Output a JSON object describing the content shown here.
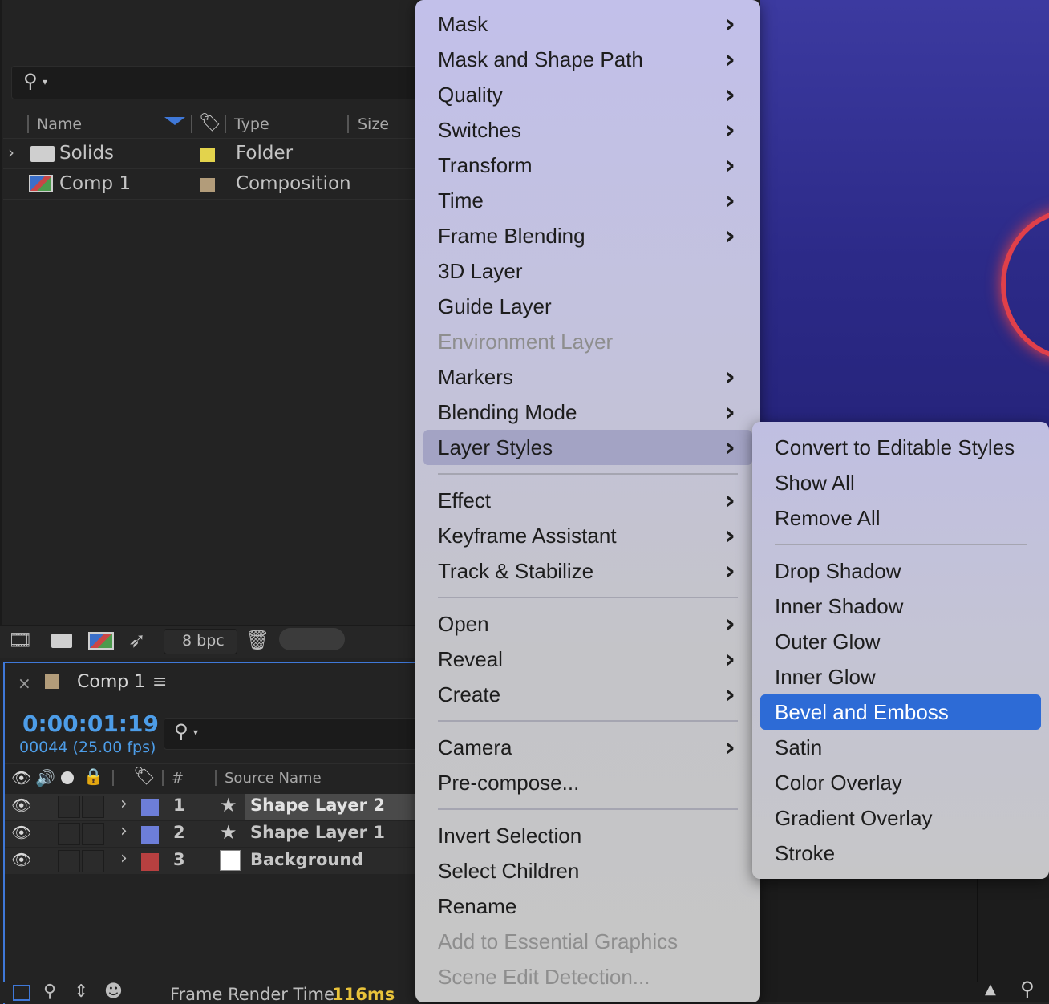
{
  "project": {
    "columns": {
      "name": "Name",
      "type": "Type",
      "size": "Size"
    },
    "items": [
      {
        "name": "Solids",
        "type": "Folder",
        "label_color": "#e3d34c"
      },
      {
        "name": "Comp 1",
        "type": "Composition",
        "label_color": "#b29c7a"
      }
    ],
    "bit_depth": "8 bpc"
  },
  "timeline": {
    "comp_tab": "Comp 1",
    "timecode": "0:00:01:19",
    "frame_info": "00044 (25.00 fps)",
    "columns": {
      "number": "#",
      "source_name": "Source Name"
    },
    "layers": [
      {
        "number": "1",
        "name": "Shape Layer 2",
        "label_color": "#6d7ed8"
      },
      {
        "number": "2",
        "name": "Shape Layer 1",
        "label_color": "#6d7ed8"
      },
      {
        "number": "3",
        "name": "Background",
        "label_color": "#b84040"
      }
    ],
    "frame_render_label": "Frame Render Time",
    "frame_render_value": "116ms"
  },
  "menu": {
    "items": [
      {
        "label": "Mask",
        "submenu": true
      },
      {
        "label": "Mask and Shape Path",
        "submenu": true
      },
      {
        "label": "Quality",
        "submenu": true
      },
      {
        "label": "Switches",
        "submenu": true
      },
      {
        "label": "Transform",
        "submenu": true
      },
      {
        "label": "Time",
        "submenu": true
      },
      {
        "label": "Frame Blending",
        "submenu": true
      },
      {
        "label": "3D Layer",
        "submenu": false
      },
      {
        "label": "Guide Layer",
        "submenu": false
      },
      {
        "label": "Environment Layer",
        "submenu": false,
        "disabled": true
      },
      {
        "label": "Markers",
        "submenu": true
      },
      {
        "label": "Blending Mode",
        "submenu": true
      },
      {
        "label": "Layer Styles",
        "submenu": true,
        "highlighted": true
      },
      {
        "label": "Effect",
        "submenu": true
      },
      {
        "label": "Keyframe Assistant",
        "submenu": true
      },
      {
        "label": "Track & Stabilize",
        "submenu": true
      },
      {
        "label": "Open",
        "submenu": true
      },
      {
        "label": "Reveal",
        "submenu": true
      },
      {
        "label": "Create",
        "submenu": true
      },
      {
        "label": "Camera",
        "submenu": true
      },
      {
        "label": "Pre-compose...",
        "submenu": false
      },
      {
        "label": "Invert Selection",
        "submenu": false
      },
      {
        "label": "Select Children",
        "submenu": false
      },
      {
        "label": "Rename",
        "submenu": false
      },
      {
        "label": "Add to Essential Graphics",
        "submenu": false,
        "disabled": true
      },
      {
        "label": "Scene Edit Detection...",
        "submenu": false,
        "disabled": true
      }
    ]
  },
  "layer_styles_menu": {
    "items": [
      {
        "label": "Convert to Editable Styles"
      },
      {
        "label": "Show All"
      },
      {
        "label": "Remove All"
      },
      {
        "label": "Drop Shadow"
      },
      {
        "label": "Inner Shadow"
      },
      {
        "label": "Outer Glow"
      },
      {
        "label": "Inner Glow"
      },
      {
        "label": "Bevel and Emboss",
        "highlighted": true
      },
      {
        "label": "Satin"
      },
      {
        "label": "Color Overlay"
      },
      {
        "label": "Gradient Overlay"
      },
      {
        "label": "Stroke"
      }
    ]
  },
  "colors": {
    "accent": "#2d6bd6",
    "timecode": "#4d9de8",
    "render_time": "#e8c23a"
  }
}
